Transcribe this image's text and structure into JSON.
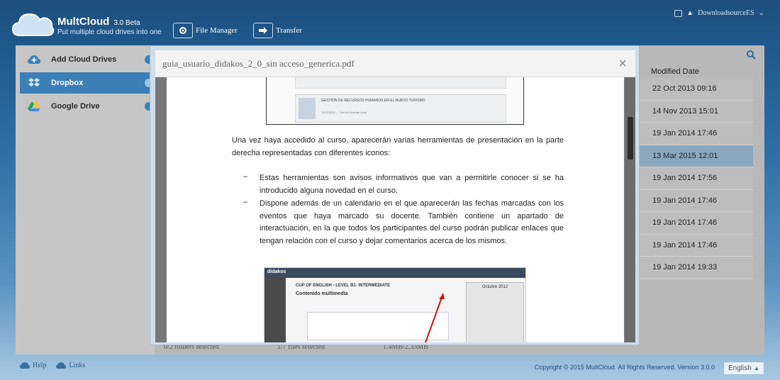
{
  "app": {
    "brand": "MultCloud",
    "version": "3.0 Beta",
    "tagline": "Put multiple cloud drives into one"
  },
  "header_nav": [
    {
      "label": "File Manager",
      "icon": "gear-icon"
    },
    {
      "label": "Transfer",
      "icon": "transfer-arrow-icon"
    }
  ],
  "user": {
    "name": "DownloadsourceES"
  },
  "sidebar": {
    "items": [
      {
        "label": "Add Cloud Drives",
        "icon": "cloud-add-icon"
      },
      {
        "label": "Dropbox",
        "icon": "dropbox-icon"
      },
      {
        "label": "Google Drive",
        "icon": "google-drive-icon"
      }
    ]
  },
  "file_list": {
    "column_modified": "Modified Date",
    "dates": [
      "22 Oct 2013 09:16",
      "14 Nov 2013 15:01",
      "19 Jan 2014 17:46",
      "13 Mar 2015 12:01",
      "19 Jan 2014 17:56",
      "19 Jan 2014 17:46",
      "19 Jan 2014 17:46",
      "19 Jan 2014 17:46",
      "19 Jan 2014 19:33"
    ],
    "selected_index": 3
  },
  "status": {
    "folders": "0/2 folders selected",
    "files": "1/7 files selected",
    "size": "1.4MB/2.33MB"
  },
  "modal": {
    "title": "guia_usuario_didakos_2_0_sin acceso_generica.pdf",
    "close": "×"
  },
  "document": {
    "shot1_caption": "GESTIÓN DE RECURSOS HUMANOS EN EL NUEVO TURISMO",
    "shot1_sub": "10/11/2014 — García Guzmán Juan",
    "para1": "Una vez haya accedido al curso, aparecerán varias herramientas de presentación en la parte derecha representadas con diferentes iconos:",
    "bullet_mark": "–",
    "bullets": [
      "Estas herramientas son avisos informativos que van a permitirle conocer si se ha introducido alguna novedad en el curso.",
      "Dispone además de un calendario en el que aparecerán las fechas marcadas con los eventos que haya marcado su docente. También contiene un apartado de interactuación, en la que todos los participantes del curso podrán publicar enlaces que tengan relación con el curso y dejar comentarios acerca de los mismos."
    ],
    "shot2": {
      "logo": "didakos",
      "course_title": "CUP OF ENGLISH - LEVEL B1- INTERMEDIATE",
      "section": "Contenido multimedia",
      "calendar_month": "Octubre 2012"
    }
  },
  "footer": {
    "help": "Help",
    "links": "Links",
    "copyright": "Copyright © 2015 MultCloud. All Rights Reserved. Version 3.0.0",
    "language": "English"
  },
  "colors": {
    "accent": "#3b7fb6",
    "selected_row": "#8aa7be"
  }
}
